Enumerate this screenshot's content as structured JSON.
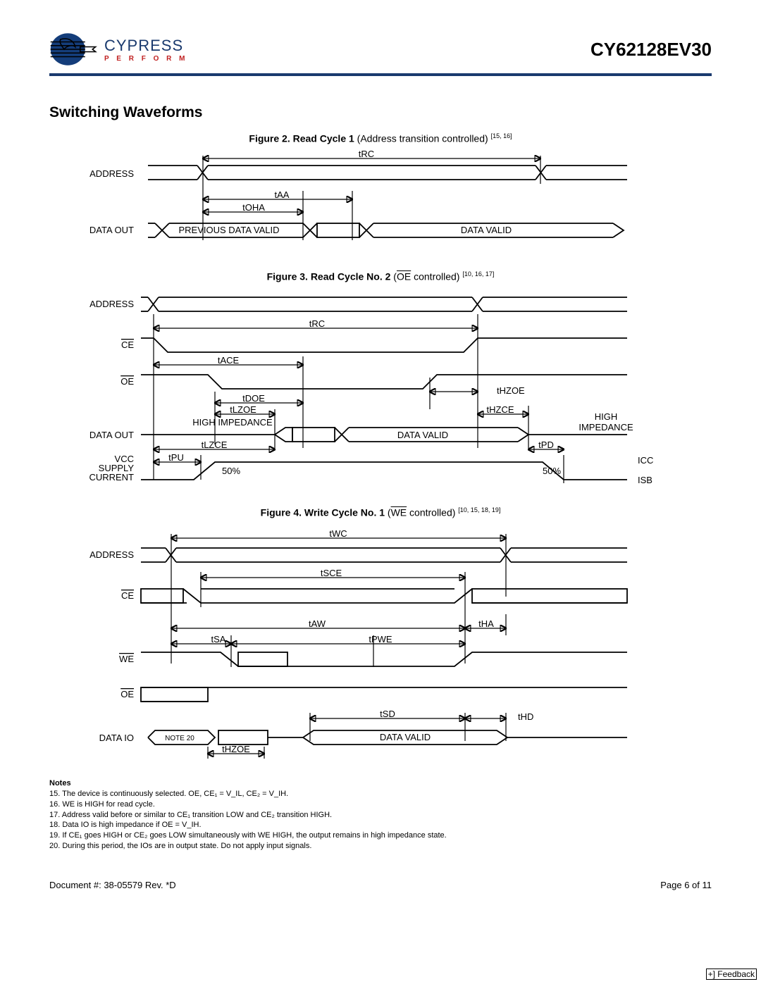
{
  "header": {
    "brand": "CYPRESS",
    "tagline": "P E R F O R M",
    "part": "CY62128EV30"
  },
  "section_title": "Switching Waveforms",
  "fig2": {
    "caption_bold": "Figure 2.  Read Cycle 1",
    "caption_rest": " (Address transition controlled) ",
    "refs": "[15, 16]",
    "sig_address": "ADDRESS",
    "sig_dataout": "DATA OUT",
    "t_rc": "tRC",
    "t_aa": "tAA",
    "t_oha": "tOHA",
    "prev_valid": "PREVIOUS DATA VALID",
    "data_valid": "DATA VALID"
  },
  "fig3": {
    "caption_bold": "Figure 3.  Read Cycle No. 2",
    "caption_rest_pre": " (",
    "caption_oe": "OE",
    "caption_rest_post": " controlled) ",
    "refs": "[10, 16, 17]",
    "sig_address": "ADDRESS",
    "sig_ce": "CE",
    "sig_oe": "OE",
    "sig_dataout": "DATA  OUT",
    "sig_vcc1": "VCC",
    "sig_vcc2": "SUPPLY",
    "sig_vcc3": "CURRENT",
    "t_rc": "tRC",
    "t_ace": "tACE",
    "t_doe": "tDOE",
    "t_lzoe": "tLZOE",
    "t_lzce": "tLZCE",
    "t_hzoe": "tHZOE",
    "t_hzce": "tHZCE",
    "t_pu": "tPU",
    "t_pd": "tPD",
    "hiz": "HIGH IMPEDANCE",
    "hiz2a": "HIGH",
    "hiz2b": "IMPEDANCE",
    "data_valid": "DATA VALID",
    "fifty": "50%",
    "icc": "ICC",
    "isb": "ISB"
  },
  "fig4": {
    "caption_bold": "Figure 4.  Write Cycle No. 1",
    "caption_rest_pre": " (",
    "caption_we": "WE",
    "caption_rest_post": " controlled) ",
    "refs": "[10, 15, 18, 19]",
    "sig_address": "ADDRESS",
    "sig_ce": "CE",
    "sig_we": "WE",
    "sig_oe": "OE",
    "sig_dataio": "DATA  IO",
    "t_wc": "tWC",
    "t_sce": "tSCE",
    "t_aw": "tAW",
    "t_ha": "tHA",
    "t_sa": "tSA",
    "t_pwe": "tPWE",
    "t_sd": "tSD",
    "t_hd": "tHD",
    "t_hzoe": "tHZOE",
    "note20": "NOTE 20",
    "data_valid": "DATA VALID"
  },
  "notes": {
    "heading": "Notes",
    "n15": "15. The device is continuously selected. OE, CE₁ = V_IL, CE₂ = V_IH.",
    "n16": "16. WE is HIGH for read cycle.",
    "n17": "17. Address valid before or similar to CE₁ transition LOW and CE₂ transition HIGH.",
    "n18": "18. Data IO is high impedance if OE = V_IH.",
    "n19": "19. If CE₁ goes HIGH or CE₂ goes LOW simultaneously with WE HIGH, the output remains in high impedance state.",
    "n20": "20. During this period, the IOs are in output state. Do not apply input signals."
  },
  "footer": {
    "doc": "Document #: 38-05579 Rev. *D",
    "page": "Page 6 of 11"
  },
  "feedback": "+] Feedback"
}
